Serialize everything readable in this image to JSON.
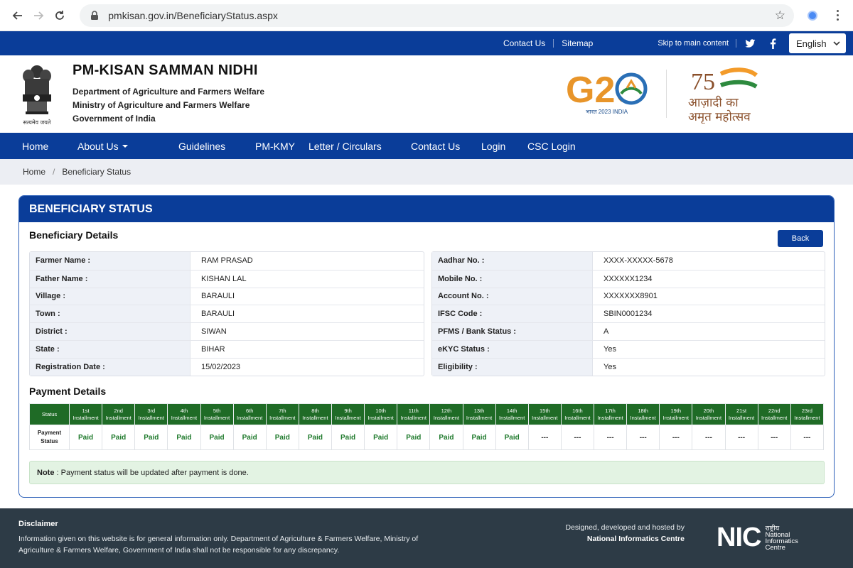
{
  "browser": {
    "url": "pmkisan.gov.in/BeneficiaryStatus.aspx"
  },
  "topbar": {
    "contact": "Contact Us",
    "sitemap": "Sitemap",
    "skip": "Skip to main content",
    "language": "English"
  },
  "header": {
    "title": "PM-KISAN SAMMAN NIDHI",
    "line1": "Department of Agriculture and Farmers Welfare",
    "line2": "Ministry of Agriculture and Farmers Welfare",
    "line3": "Government of India",
    "emblem_motto": "सत्यमेव जयते",
    "g20_text": "G20",
    "g20_sub": "भारत 2023 INDIA",
    "aka_line1": "आज़ादी का",
    "aka_line2": "अमृत महोत्सव"
  },
  "nav": {
    "items": [
      "Home",
      "About Us",
      "Guidelines",
      "PM-KMY",
      "Letter / Circulars",
      "Contact Us",
      "Login",
      "CSC Login"
    ]
  },
  "breadcrumb": {
    "home": "Home",
    "current": "Beneficiary Status"
  },
  "card": {
    "title": "BENEFICIARY STATUS",
    "details_title": "Beneficiary Details",
    "back_label": "Back",
    "left": [
      {
        "label": "Farmer Name :",
        "value": "RAM PRASAD"
      },
      {
        "label": "Father Name :",
        "value": "KISHAN LAL"
      },
      {
        "label": "Village :",
        "value": "BARAULI"
      },
      {
        "label": "Town :",
        "value": "BARAULI"
      },
      {
        "label": "District :",
        "value": "SIWAN"
      },
      {
        "label": "State :",
        "value": "BIHAR"
      },
      {
        "label": "Registration Date :",
        "value": "15/02/2023"
      }
    ],
    "right": [
      {
        "label": "Aadhar No. :",
        "value": "XXXX-XXXXX-5678"
      },
      {
        "label": "Mobile No. :",
        "value": "XXXXXX1234"
      },
      {
        "label": "Account No. :",
        "value": "XXXXXXX8901"
      },
      {
        "label": "IFSC Code :",
        "value": "SBIN0001234"
      },
      {
        "label": "PFMS / Bank Status :",
        "value": "A"
      },
      {
        "label": "eKYC Status :",
        "value": "Yes"
      },
      {
        "label": "Eligibility :",
        "value": "Yes"
      }
    ],
    "payment_title": "Payment Details",
    "payment_status_header": "Status",
    "payment_row_label": "Payment Status",
    "installment_word": "Installment",
    "installments": [
      {
        "n": "1st",
        "status": "Paid"
      },
      {
        "n": "2nd",
        "status": "Paid"
      },
      {
        "n": "3rd",
        "status": "Paid"
      },
      {
        "n": "4th",
        "status": "Paid"
      },
      {
        "n": "5th",
        "status": "Paid"
      },
      {
        "n": "6th",
        "status": "Paid"
      },
      {
        "n": "7th",
        "status": "Paid"
      },
      {
        "n": "8th",
        "status": "Paid"
      },
      {
        "n": "9th",
        "status": "Paid"
      },
      {
        "n": "10th",
        "status": "Paid"
      },
      {
        "n": "11th",
        "status": "Paid"
      },
      {
        "n": "12th",
        "status": "Paid"
      },
      {
        "n": "13th",
        "status": "Paid"
      },
      {
        "n": "14th",
        "status": "Paid"
      },
      {
        "n": "15th",
        "status": "---"
      },
      {
        "n": "16th",
        "status": "---"
      },
      {
        "n": "17th",
        "status": "---"
      },
      {
        "n": "18th",
        "status": "---"
      },
      {
        "n": "19th",
        "status": "---"
      },
      {
        "n": "20th",
        "status": "---"
      },
      {
        "n": "21st",
        "status": "---"
      },
      {
        "n": "22nd",
        "status": "---"
      },
      {
        "n": "23rd",
        "status": "---"
      }
    ],
    "note_label": "Note",
    "note_text": ": Payment status will be updated after payment is done."
  },
  "footer": {
    "disclaimer_title": "Disclaimer",
    "disclaimer_line1": "Information given on this website is for general information only.  Department of Agriculture  & Farmers Welfare, Ministry of",
    "disclaimer_line2": "Agriculture & Farmers Welfare, Government of India shall not be responsible for any discrepancy.",
    "designed_by": "Designed, developed and hosted by",
    "nic_name": "National Informatics Centre",
    "nic_logo_text": "NIC",
    "nic_hindi": "राष्ट्रीय",
    "nic_line1": "National",
    "nic_line2": "Informatics",
    "nic_line3": "Centre"
  },
  "colors": {
    "primary_blue": "#0a3d99",
    "table_green": "#1f6b26",
    "paid_green": "#1f7a2c",
    "footer_bg": "#2d3b46"
  }
}
